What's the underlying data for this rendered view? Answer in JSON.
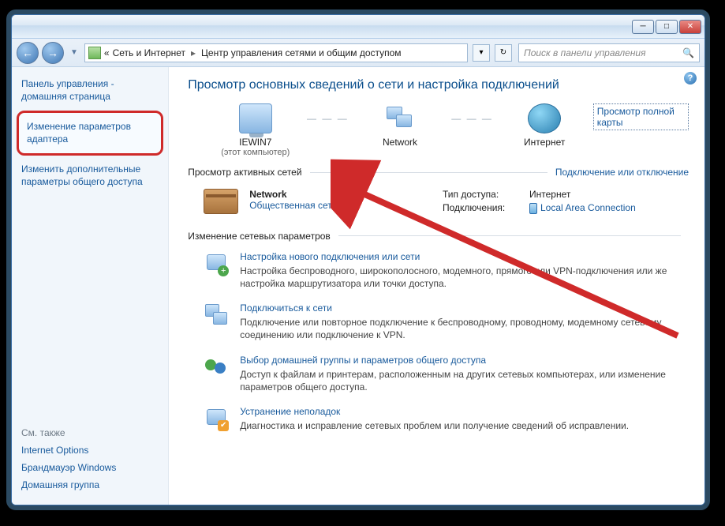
{
  "breadcrumb": {
    "prefix": "«",
    "part1": "Сеть и Интернет",
    "part2": "Центр управления сетями и общим доступом"
  },
  "search": {
    "placeholder": "Поиск в панели управления"
  },
  "sidebar": {
    "home": "Панель управления - домашняя страница",
    "adapter": "Изменение параметров адаптера",
    "advanced": "Изменить дополнительные параметры общего доступа",
    "see_also": "См. также",
    "links": {
      "internet_options": "Internet Options",
      "firewall": "Брандмауэр Windows",
      "homegroup": "Домашняя группа"
    }
  },
  "main": {
    "title": "Просмотр основных сведений о сети и настройка подключений",
    "diagram": {
      "computer_name": "IEWIN7",
      "computer_sub": "(этот компьютер)",
      "network_label": "Network",
      "internet_label": "Интернет",
      "map_link": "Просмотр полной карты"
    },
    "active_heading": "Просмотр активных сетей",
    "active_link": "Подключение или отключение",
    "active": {
      "name": "Network",
      "type": "Общественная сеть",
      "access_lbl": "Тип доступа:",
      "access_val": "Интернет",
      "conn_lbl": "Подключения:",
      "conn_val": "Local Area Connection"
    },
    "change_heading": "Изменение сетевых параметров",
    "items": [
      {
        "title": "Настройка нового подключения или сети",
        "desc": "Настройка беспроводного, широкополосного, модемного, прямого или VPN-подключения или же настройка маршрутизатора или точки доступа."
      },
      {
        "title": "Подключиться к сети",
        "desc": "Подключение или повторное подключение к беспроводному, проводному, модемному сетевому соединению или подключение к VPN."
      },
      {
        "title": "Выбор домашней группы и параметров общего доступа",
        "desc": "Доступ к файлам и принтерам, расположенным на других сетевых компьютерах, или изменение параметров общего доступа."
      },
      {
        "title": "Устранение неполадок",
        "desc": "Диагностика и исправление сетевых проблем или получение сведений об исправлении."
      }
    ]
  }
}
